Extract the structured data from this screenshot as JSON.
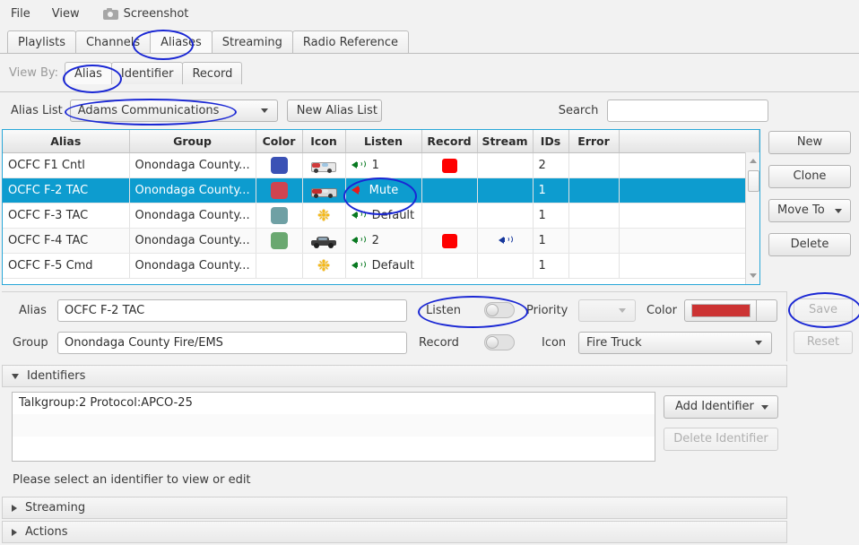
{
  "menubar": {
    "items": [
      {
        "label": "File",
        "icon": null
      },
      {
        "label": "View",
        "icon": null
      },
      {
        "label": "Screenshot",
        "icon": "camera-icon"
      }
    ]
  },
  "tabs": {
    "items": [
      {
        "label": "Playlists",
        "active": false
      },
      {
        "label": "Channels",
        "active": false
      },
      {
        "label": "Aliases",
        "active": true
      },
      {
        "label": "Streaming",
        "active": false
      },
      {
        "label": "Radio Reference",
        "active": false
      }
    ]
  },
  "view_by": {
    "label": "View By:",
    "items": [
      {
        "label": "Alias",
        "active": true
      },
      {
        "label": "Identifier",
        "active": false
      },
      {
        "label": "Record",
        "active": false
      }
    ]
  },
  "alias_list_bar": {
    "label": "Alias List",
    "selected": "Adams Communications",
    "new_list_button": "New Alias List",
    "search_label": "Search",
    "search_value": "",
    "search_placeholder": ""
  },
  "table": {
    "columns": [
      "Alias",
      "Group",
      "Color",
      "Icon",
      "Listen",
      "Record",
      "Stream",
      "IDs",
      "Error",
      ""
    ],
    "rows": [
      {
        "alias": "OCFC F1 Cntl",
        "group": "Onondaga County...",
        "color": "#3a51b5",
        "icon": "ambulance-icon",
        "listen": "1",
        "listen_state": "unmuted",
        "record": true,
        "stream": false,
        "ids": "2",
        "error": "",
        "selected": false
      },
      {
        "alias": "OCFC F-2 TAC",
        "group": "Onondaga County...",
        "color": "#cf4450",
        "icon": "fire-truck-icon",
        "listen": "Mute",
        "listen_state": "muted",
        "record": false,
        "stream": false,
        "ids": "1",
        "error": "",
        "selected": true
      },
      {
        "alias": "OCFC F-3 TAC",
        "group": "Onondaga County...",
        "color": "#6fa0a4",
        "icon": "star-icon",
        "listen": "Default",
        "listen_state": "unmuted",
        "record": false,
        "stream": false,
        "ids": "1",
        "error": "",
        "selected": false
      },
      {
        "alias": "OCFC F-4 TAC",
        "group": "Onondaga County...",
        "color": "#6aa870",
        "icon": "police-car-icon",
        "listen": "2",
        "listen_state": "unmuted",
        "record": true,
        "stream": true,
        "ids": "1",
        "error": "",
        "selected": false
      },
      {
        "alias": "OCFC F-5 Cmd",
        "group": "Onondaga County...",
        "color": null,
        "icon": "star-icon",
        "listen": "Default",
        "listen_state": "unmuted",
        "record": false,
        "stream": false,
        "ids": "1",
        "error": "",
        "selected": false
      }
    ]
  },
  "side_buttons": {
    "new": "New",
    "clone": "Clone",
    "move_to": "Move To",
    "delete": "Delete"
  },
  "editor": {
    "alias_label": "Alias",
    "alias_value": "OCFC F-2 TAC",
    "group_label": "Group",
    "group_value": "Onondaga County Fire/EMS",
    "listen_label": "Listen",
    "listen_on": false,
    "record_label": "Record",
    "record_on": false,
    "priority_label": "Priority",
    "priority_value": "",
    "icon_label": "Icon",
    "icon_value": "Fire Truck",
    "color_label": "Color",
    "color_value": "#cc3333",
    "save": "Save",
    "reset": "Reset"
  },
  "identifiers": {
    "section_title": "Identifiers",
    "expanded": true,
    "items": [
      "Talkgroup:2 Protocol:APCO-25"
    ],
    "add_button": "Add Identifier",
    "delete_button": "Delete Identifier",
    "hint": "Please select an identifier to view or edit"
  },
  "sections": [
    {
      "title": "Streaming",
      "expanded": false
    },
    {
      "title": "Actions",
      "expanded": false
    }
  ],
  "theme": {
    "selection_blue": "#0d9ccf",
    "annotation_blue": "#1a27d4",
    "record_red": "#fe0000"
  }
}
